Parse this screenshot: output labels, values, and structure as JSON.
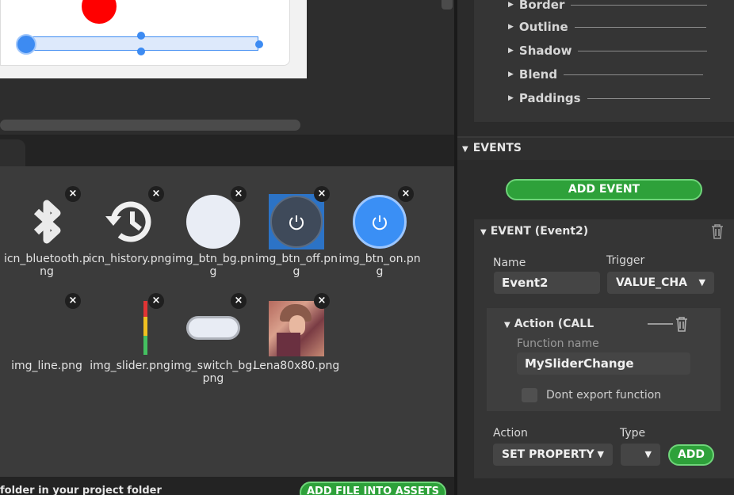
{
  "style_sections": [
    {
      "label": "Border"
    },
    {
      "label": "Outline"
    },
    {
      "label": "Shadow"
    },
    {
      "label": "Blend"
    },
    {
      "label": "Paddings"
    }
  ],
  "events": {
    "header": "EVENTS",
    "add_event_label": "ADD EVENT",
    "event_title": "EVENT (Event2)",
    "name_label": "Name",
    "name_value": "Event2",
    "trigger_label": "Trigger",
    "trigger_value": "VALUE_CHA",
    "action_title": "Action (CALL",
    "function_name_label": "Function name",
    "function_name_value": "MySliderChange",
    "dont_export_label": "Dont export function",
    "dont_export_checked": false,
    "action_label": "Action",
    "action_value": "SET PROPERTY",
    "type_label": "Type",
    "type_value": "",
    "add_label": "ADD"
  },
  "assets": {
    "items": [
      {
        "name": "icn_bluetooth.png",
        "icon": "bluetooth-icon"
      },
      {
        "name": "icn_history.png",
        "icon": "history-icon"
      },
      {
        "name": "img_btn_bg.png",
        "icon": "button-background-image"
      },
      {
        "name": "img_btn_off.png",
        "icon": "power-off-image"
      },
      {
        "name": "img_btn_on.png",
        "icon": "power-on-image"
      },
      {
        "name": "img_line.png",
        "icon": "line-image"
      },
      {
        "name": "img_slider.png",
        "icon": "slider-image"
      },
      {
        "name": "img_switch_bg.png",
        "icon": "switch-background-image"
      },
      {
        "name": "Lena80x80.png",
        "icon": "photo-image"
      }
    ],
    "remove_glyph": "×",
    "footer_text": "folder in your project folder",
    "add_file_label": "ADD FILE INTO ASSETS"
  },
  "colors": {
    "accent_green": "#2ea13a",
    "selection_blue": "#3d8bf2",
    "knob_red": "#ff0000"
  }
}
